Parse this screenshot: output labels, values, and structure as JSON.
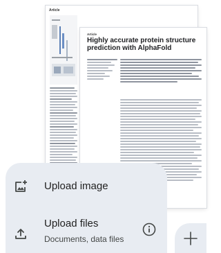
{
  "preview": {
    "back_page_label": "Article",
    "front_page_label": "Article",
    "paper_title": "Highly accurate protein structure prediction with AlphaFold"
  },
  "upload_menu": {
    "items": [
      {
        "label": "Upload image",
        "icon": "add-photo-icon"
      },
      {
        "label": "Upload files",
        "sublabel": "Documents, data files",
        "icon": "upload-icon",
        "trailing_icon": "info-icon"
      }
    ]
  },
  "fab": {
    "icon": "plus-icon"
  },
  "colors": {
    "menu_background": "#e8ecf2",
    "text_primary": "#1f1f1f",
    "text_secondary": "#444746",
    "icon": "#444746"
  }
}
